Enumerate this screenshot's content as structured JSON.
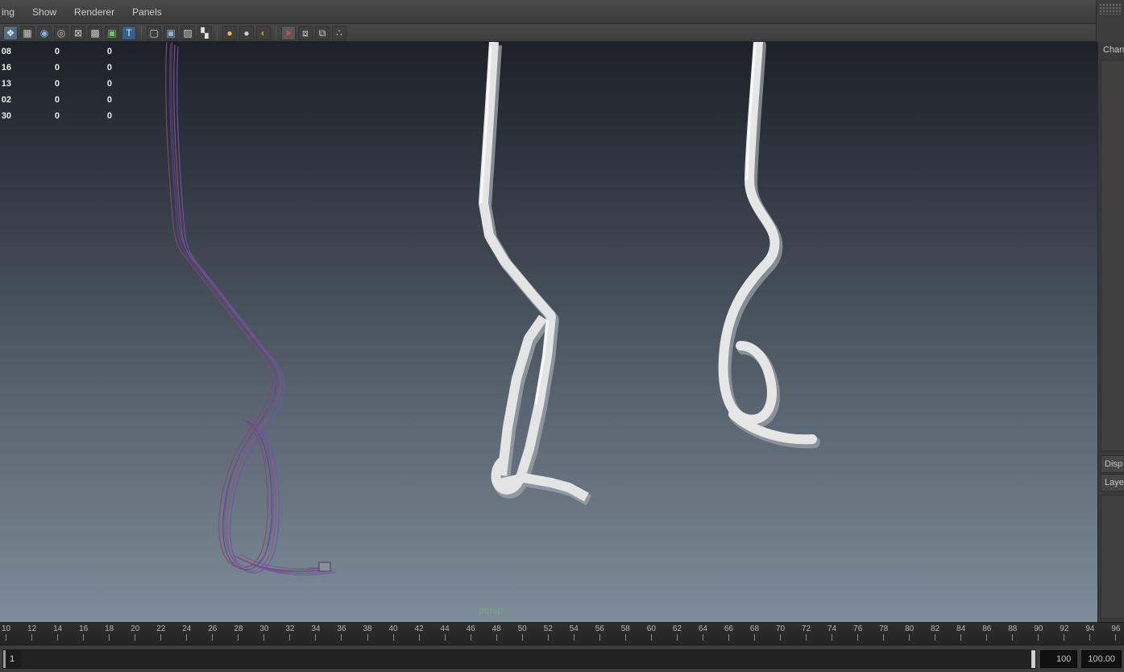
{
  "menu_bar": {
    "items": [
      {
        "label": "ing"
      },
      {
        "label": "Show"
      },
      {
        "label": "Renderer"
      },
      {
        "label": "Panels"
      }
    ]
  },
  "toolbar": {
    "icons": [
      {
        "kind": "icon",
        "name": "select-camera-icon",
        "glyph": "❖",
        "color": "#d8e6f2",
        "bg": "#4e6f88"
      },
      {
        "kind": "icon",
        "name": "grid-icon",
        "glyph": "▦",
        "color": "#c8c8c8"
      },
      {
        "kind": "icon",
        "name": "film-gate-icon",
        "glyph": "◉",
        "color": "#7fb3e0"
      },
      {
        "kind": "icon",
        "name": "resolution-gate-icon",
        "glyph": "◎",
        "color": "#c0c0c0"
      },
      {
        "kind": "icon",
        "name": "gate-mask-icon",
        "glyph": "⊠",
        "color": "#c8c8c8"
      },
      {
        "kind": "icon",
        "name": "field-chart-icon",
        "glyph": "▩",
        "color": "#c8c8c8"
      },
      {
        "kind": "icon",
        "name": "safe-action-icon",
        "glyph": "▣",
        "color": "#6fbf6f"
      },
      {
        "kind": "icon",
        "name": "safe-title-icon",
        "glyph": "T",
        "color": "#e8e8e8",
        "bg": "#35608d"
      },
      {
        "kind": "sep"
      },
      {
        "kind": "icon",
        "name": "wireframe-icon",
        "glyph": "▢",
        "color": "#cccccc"
      },
      {
        "kind": "icon",
        "name": "shaded-icon",
        "glyph": "▣",
        "color": "#84b7dd"
      },
      {
        "kind": "icon",
        "name": "textured-icon",
        "glyph": "▨",
        "color": "#cccccc"
      },
      {
        "kind": "icon",
        "name": "use-default-material-icon",
        "glyph": "▚",
        "color": "#e0e0e0"
      },
      {
        "kind": "sep"
      },
      {
        "kind": "icon",
        "name": "all-lights-icon",
        "glyph": "●",
        "color": "#e9c32a"
      },
      {
        "kind": "icon",
        "name": "default-lighting-icon",
        "glyph": "●",
        "color": "#cfcfcf"
      },
      {
        "kind": "icon",
        "name": "no-lights-icon",
        "glyph": "◐",
        "color": "#b8922a"
      },
      {
        "kind": "sep"
      },
      {
        "kind": "icon",
        "name": "isolate-select-icon",
        "glyph": "➤",
        "color": "#d14b4b",
        "bg": "#585858"
      },
      {
        "kind": "icon",
        "name": "wire-on-shaded-icon",
        "glyph": "⧈",
        "color": "#cccccc"
      },
      {
        "kind": "icon",
        "name": "two-sided-lighting-icon",
        "glyph": "⧉",
        "color": "#cccccc"
      },
      {
        "kind": "icon",
        "name": "plugin-shapes-icon",
        "glyph": "∴",
        "color": "#cccccc"
      }
    ]
  },
  "hud": {
    "rows": [
      [
        "08",
        "0",
        "0"
      ],
      [
        "16",
        "0",
        "0"
      ],
      [
        "13",
        "0",
        "0"
      ],
      [
        "02",
        "0",
        "0"
      ],
      [
        "30",
        "0",
        "0"
      ]
    ]
  },
  "viewport": {
    "camera_label": "persp",
    "background_top": "#1d2127",
    "background_bottom": "#7e8c99",
    "wireframe_colors": [
      "#4a4aa8",
      "#a84a70"
    ],
    "tube_color": "#e4e4e4"
  },
  "right_panel": {
    "title": "Chan",
    "tabs": [
      "Disp",
      "Laye"
    ]
  },
  "timeline": {
    "tick_labels": [
      "10",
      "12",
      "14",
      "16",
      "18",
      "20",
      "22",
      "24",
      "26",
      "28",
      "30",
      "32",
      "34",
      "36",
      "38",
      "40",
      "42",
      "44",
      "46",
      "48",
      "50",
      "52",
      "54",
      "56",
      "58",
      "60",
      "62",
      "64",
      "66",
      "68",
      "70",
      "72",
      "74",
      "76",
      "78",
      "80",
      "82",
      "84",
      "86",
      "88",
      "90",
      "92",
      "94",
      "96"
    ]
  },
  "range_bar": {
    "start_frame": "1",
    "end_frame": "100",
    "end_time": "100.00"
  }
}
